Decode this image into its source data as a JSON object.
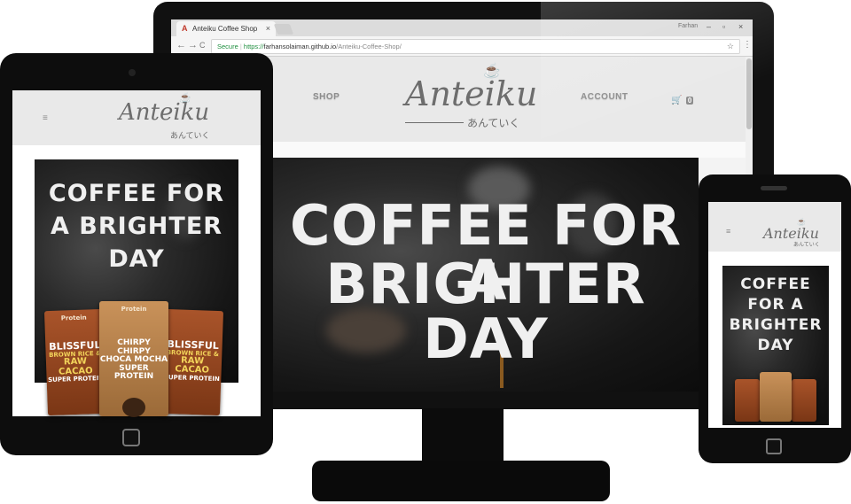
{
  "browser": {
    "tab_title": "Anteiku Coffee Shop",
    "tab_close": "×",
    "tab_favicon": "A",
    "profile_name": "Farhan",
    "url_secure_label": "Secure",
    "url_scheme": "https://",
    "url_host": "farhansolaiman.github.io",
    "url_path": "/Anteiku-Coffee-Shop/",
    "back_icon": "←",
    "forward_icon": "→",
    "reload_icon": "C",
    "lock_icon": "🔒",
    "star_icon": "☆",
    "menu_icon": "⋮",
    "win_minimize": "–",
    "win_maximize": "▫",
    "win_close": "×"
  },
  "site": {
    "nav_shop": "SHOP",
    "nav_account": "ACCOUNT",
    "cart_icon": "🛒",
    "cart_count": "0",
    "hamburger_icon": "≡",
    "logo_text": "Anteiku",
    "logo_subtext": "あんていく",
    "cup_icon": "☕",
    "hero_line_1": "COFFEE FOR A",
    "hero_line_2": "BRIGHTER DAY",
    "tablet_hero_lines": [
      "COFFEE FOR",
      "A BRIGHTER",
      "DAY"
    ],
    "phone_hero_lines": [
      "COFFEE",
      "FOR A",
      "BRIGHTER",
      "DAY"
    ]
  },
  "products": {
    "left": {
      "brand": "Protein",
      "line1": "BLISSFUL",
      "line2": "BROWN RICE &",
      "line3": "RAW CACAO",
      "line4": "SUPER PROTEIN"
    },
    "center": {
      "brand": "Protein",
      "line1": "CHIRPY CHIRPY",
      "line2": "CHOCA MOCHA",
      "line3": "SUPER PROTEIN"
    },
    "right": {
      "brand": "",
      "line1": "BLISSFUL",
      "line2": "BROWN RICE &",
      "line3": "RAW CACAO",
      "line4": "SUPER PROTEIN"
    }
  },
  "colors": {
    "device_frame": "#111111",
    "header_bg": "#e9e9e9",
    "logo_gray": "#6d6d6d",
    "hero_text": "#f0f0f0",
    "secure_green": "#1e8e3e"
  }
}
